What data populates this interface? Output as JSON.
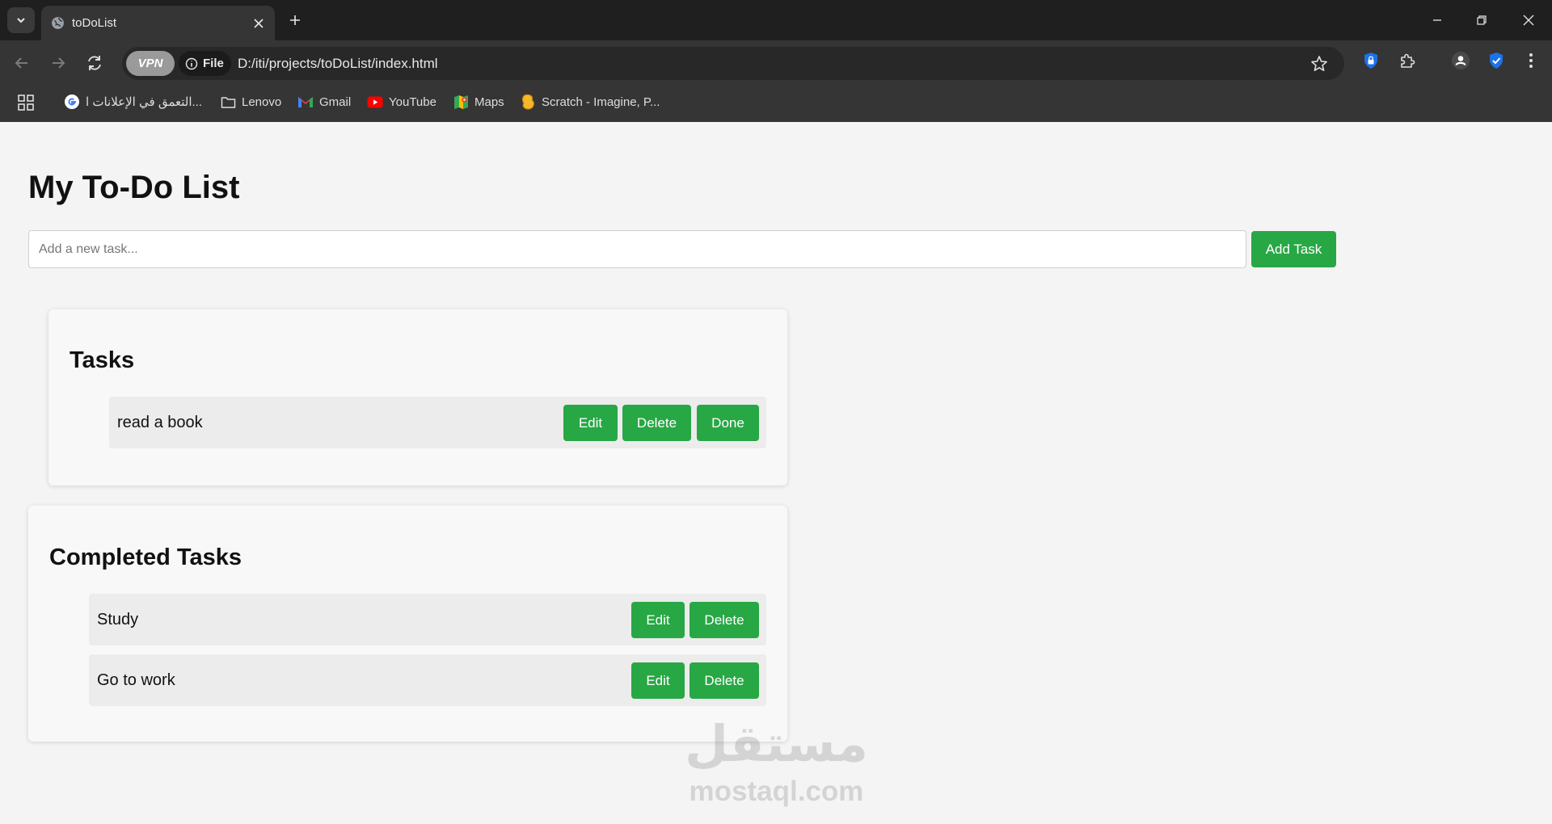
{
  "browser": {
    "tab_title": "toDoList",
    "vpn_label": "VPN",
    "file_label": "File",
    "url": "D:/iti/projects/toDoList/index.html",
    "bookmarks": [
      {
        "label": "التعمق في الإعلانات ا...",
        "icon": "google-icon"
      },
      {
        "label": "Lenovo",
        "icon": "folder-icon"
      },
      {
        "label": "Gmail",
        "icon": "gmail-icon"
      },
      {
        "label": "YouTube",
        "icon": "youtube-icon"
      },
      {
        "label": "Maps",
        "icon": "maps-icon"
      },
      {
        "label": "Scratch - Imagine, P...",
        "icon": "scratch-icon"
      }
    ]
  },
  "page": {
    "title": "My To-Do List",
    "input_placeholder": "Add a new task...",
    "add_button": "Add Task",
    "tasks_heading": "Tasks",
    "tasks": [
      {
        "text": "read a book",
        "edit": "Edit",
        "delete": "Delete",
        "done": "Done"
      }
    ],
    "completed_heading": "Completed Tasks",
    "completed": [
      {
        "text": "Study",
        "edit": "Edit",
        "delete": "Delete"
      },
      {
        "text": "Go to work",
        "edit": "Edit",
        "delete": "Delete"
      }
    ]
  },
  "watermark": {
    "arabic": "مستقل",
    "latin": "mostaql.com"
  },
  "colors": {
    "accent": "#28a745",
    "chrome_bg": "#1f1f1f",
    "page_bg": "#f4f4f4"
  }
}
